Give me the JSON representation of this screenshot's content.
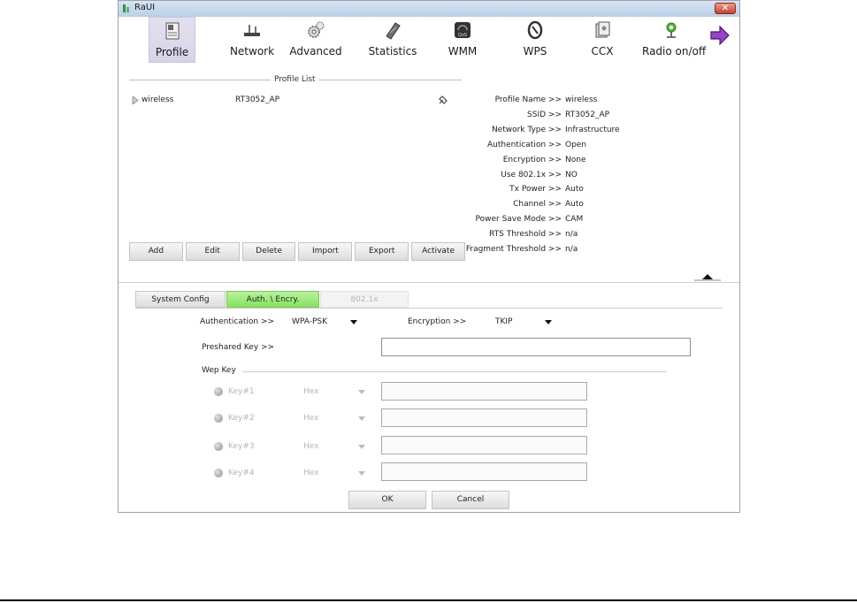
{
  "window": {
    "title": "RaUI",
    "close_label": "✕"
  },
  "toolbar": {
    "items": [
      {
        "label": "Profile",
        "icon": "profile-icon"
      },
      {
        "label": "Network",
        "icon": "network-icon"
      },
      {
        "label": "Advanced",
        "icon": "advanced-gear-icon"
      },
      {
        "label": "Statistics",
        "icon": "statistics-icon"
      },
      {
        "label": "WMM",
        "icon": "wmm-icon"
      },
      {
        "label": "WPS",
        "icon": "wps-icon"
      },
      {
        "label": "CCX",
        "icon": "ccx-icon"
      },
      {
        "label": "Radio on/off",
        "icon": "radio-icon"
      }
    ],
    "next_icon": "next-arrow-icon"
  },
  "profile_list": {
    "title": "Profile List",
    "rows": [
      {
        "name": "wireless",
        "ssid": "RT3052_AP",
        "status_icon": "connected-icon"
      }
    ],
    "buttons": [
      "Add",
      "Edit",
      "Delete",
      "Import",
      "Export",
      "Activate"
    ]
  },
  "profile_info": [
    {
      "key": "Profile Name >>",
      "value": "wireless"
    },
    {
      "key": "SSID >>",
      "value": "RT3052_AP"
    },
    {
      "key": "Network Type >>",
      "value": "Infrastructure"
    },
    {
      "key": "Authentication >>",
      "value": "Open"
    },
    {
      "key": "Encryption >>",
      "value": "None"
    },
    {
      "key": "Use 802.1x >>",
      "value": "NO"
    },
    {
      "key": "Tx Power >>",
      "value": "Auto"
    },
    {
      "key": "Channel >>",
      "value": "Auto"
    },
    {
      "key": "Power Save Mode >>",
      "value": "CAM"
    },
    {
      "key": "RTS Threshold >>",
      "value": "n/a"
    },
    {
      "key": "Fragment Threshold >>",
      "value": "n/a"
    }
  ],
  "tabs": [
    "System Config",
    "Auth. \\ Encry.",
    "802.1x"
  ],
  "auth": {
    "auth_label": "Authentication >>",
    "auth_value": "WPA-PSK",
    "enc_label": "Encryption >>",
    "enc_value": "TKIP",
    "psk_label": "Preshared Key >>",
    "psk_value": ""
  },
  "wep": {
    "title": "Wep Key",
    "keys": [
      {
        "label": "Key#1",
        "format": "Hex"
      },
      {
        "label": "Key#2",
        "format": "Hex"
      },
      {
        "label": "Key#3",
        "format": "Hex"
      },
      {
        "label": "Key#4",
        "format": "Hex"
      }
    ]
  },
  "actions": {
    "ok": "OK",
    "cancel": "Cancel"
  }
}
